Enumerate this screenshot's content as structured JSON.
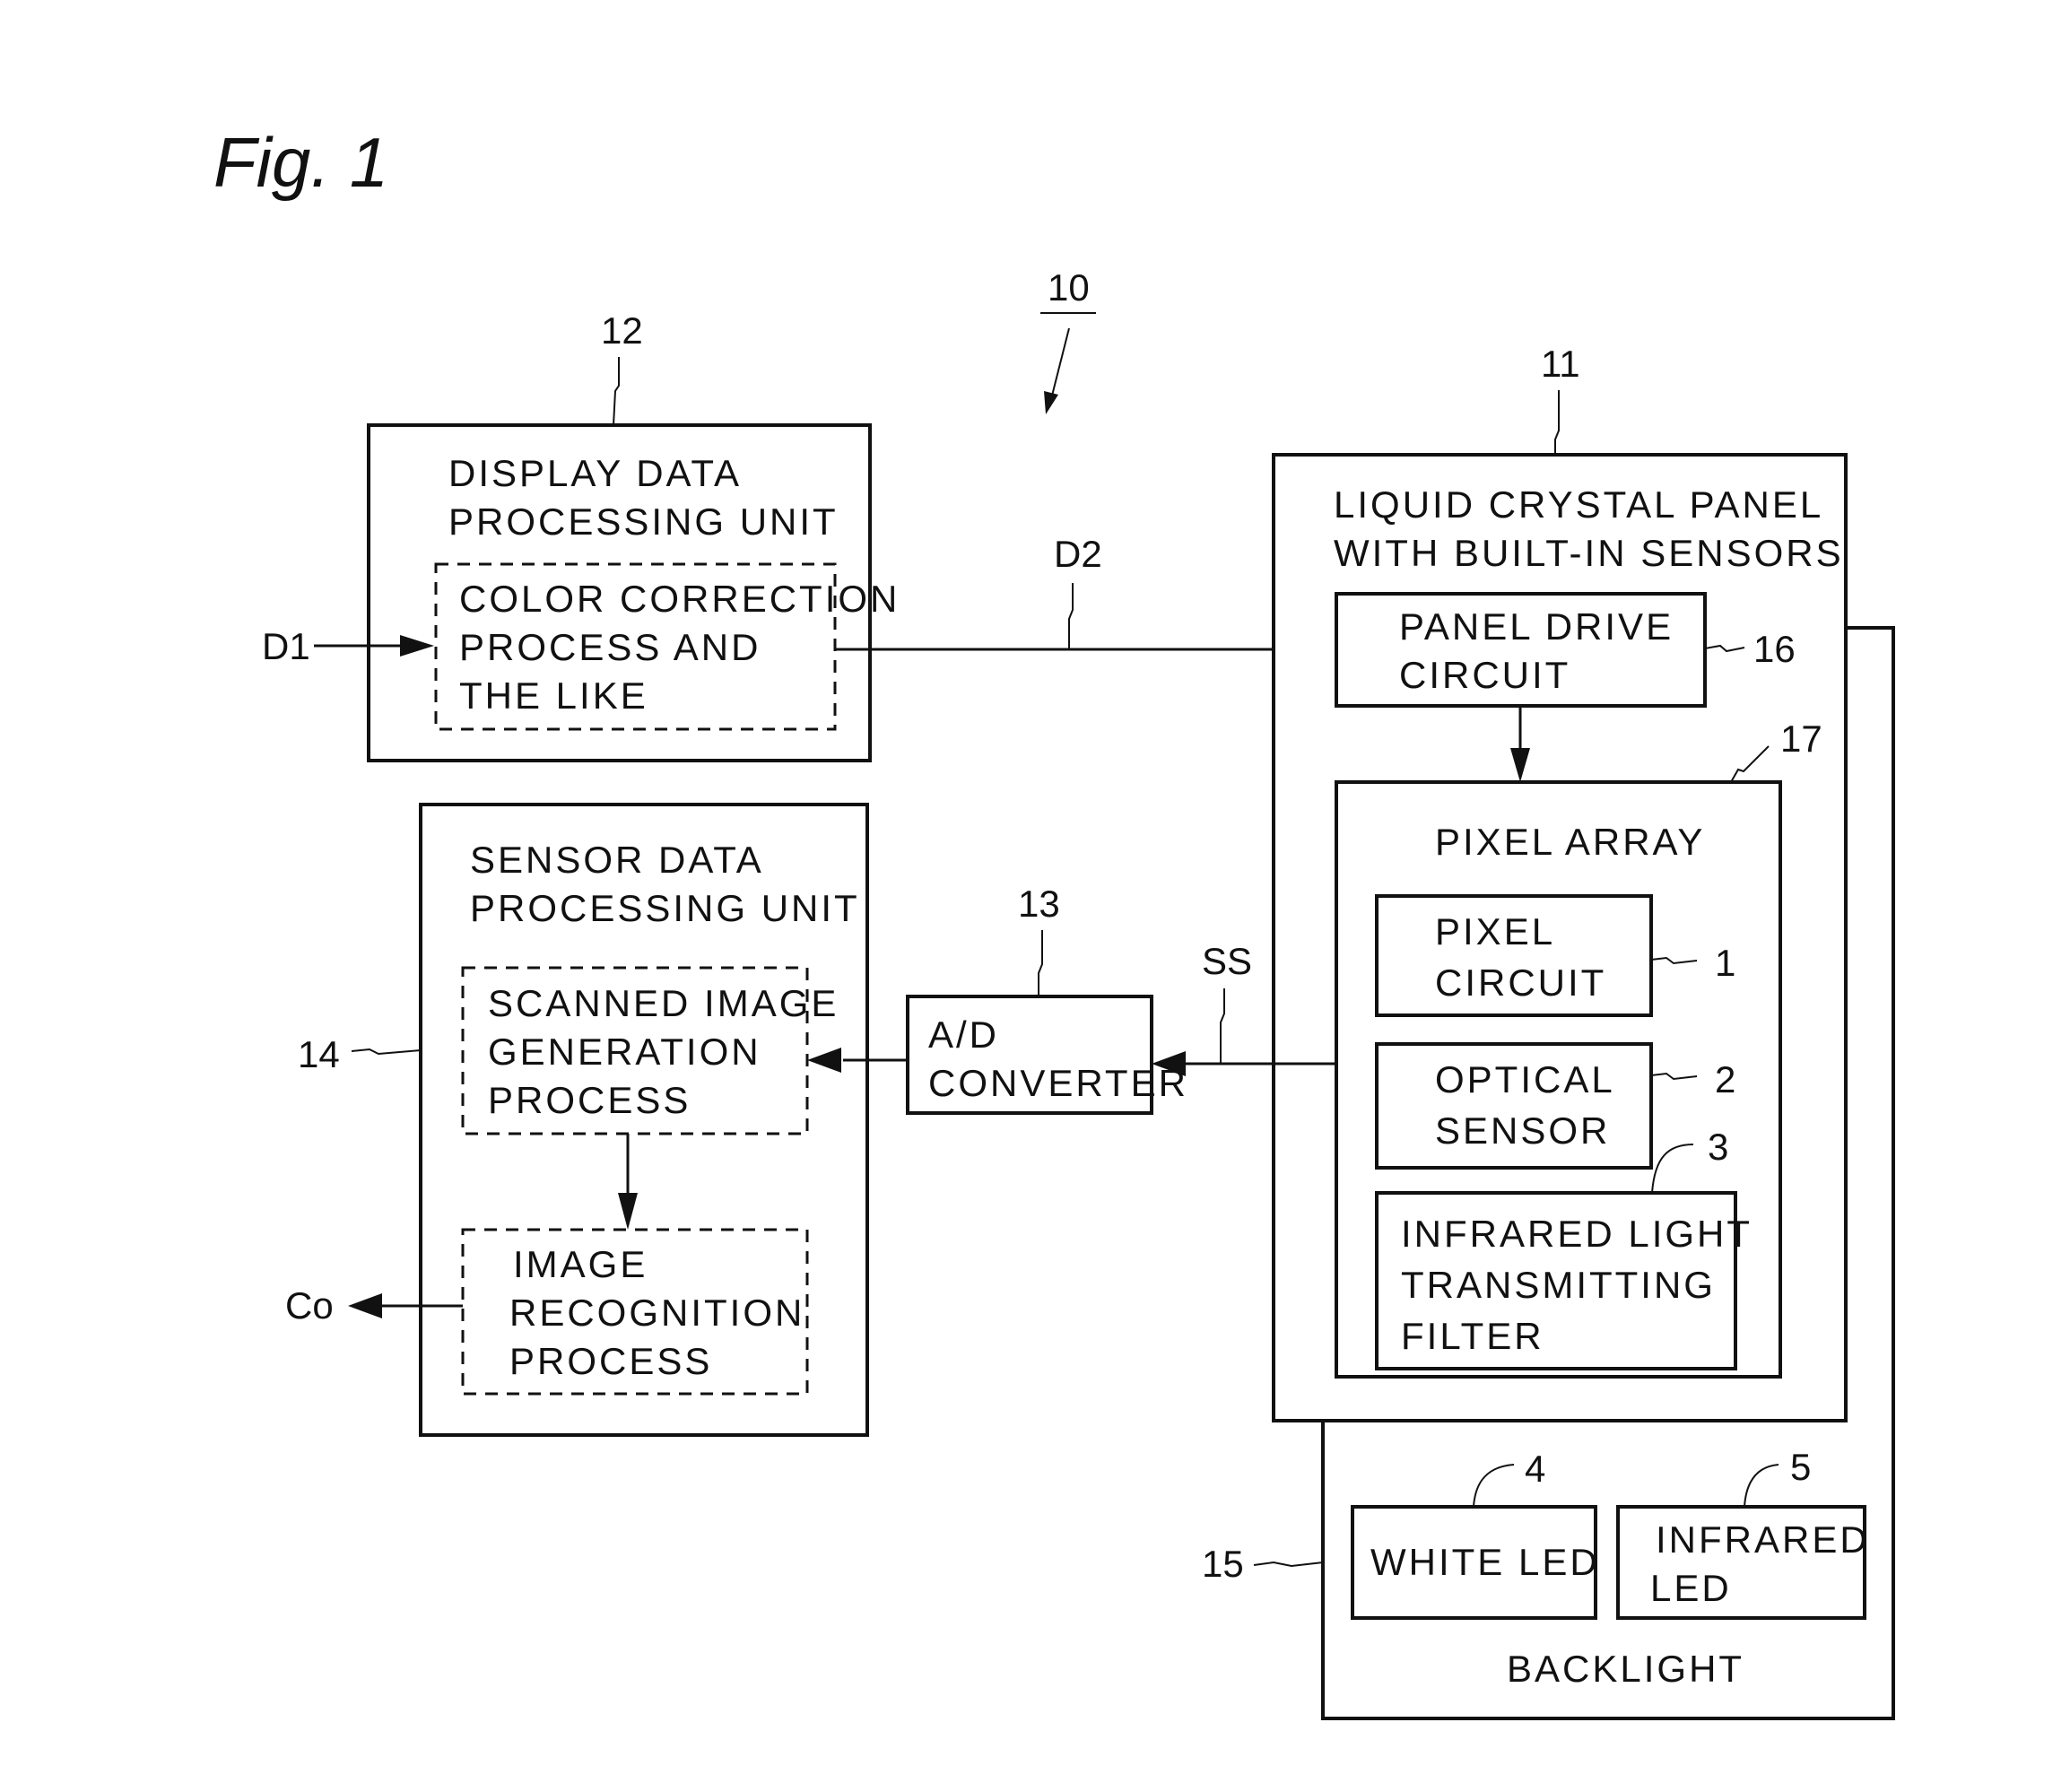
{
  "figure": {
    "title": "Fig. 1",
    "system_ref": "10"
  },
  "blocks": {
    "display_unit": {
      "ref": "12",
      "lines": [
        "DISPLAY DATA",
        "PROCESSING UNIT"
      ],
      "inner": {
        "lines": [
          "COLOR CORRECTION",
          "PROCESS AND",
          "THE LIKE"
        ]
      }
    },
    "lcd_panel": {
      "ref": "11",
      "lines": [
        "LIQUID CRYSTAL PANEL",
        "WITH BUILT-IN SENSORS"
      ]
    },
    "panel_drive": {
      "ref": "16",
      "lines": [
        "PANEL DRIVE",
        "CIRCUIT"
      ]
    },
    "pixel_array": {
      "ref": "17",
      "title": "PIXEL ARRAY"
    },
    "pixel_circuit": {
      "ref": "1",
      "lines": [
        "PIXEL",
        "CIRCUIT"
      ]
    },
    "optical_sensor": {
      "ref": "2",
      "lines": [
        "OPTICAL",
        "SENSOR"
      ]
    },
    "ir_filter": {
      "ref": "3",
      "lines": [
        "INFRARED LIGHT",
        "TRANSMITTING",
        "FILTER"
      ]
    },
    "sensor_unit": {
      "ref": "14",
      "lines": [
        "SENSOR DATA",
        "PROCESSING UNIT"
      ],
      "scanned": {
        "lines": [
          "SCANNED IMAGE",
          "GENERATION",
          "PROCESS"
        ]
      },
      "recognition": {
        "lines": [
          "IMAGE",
          "RECOGNITION",
          "PROCESS"
        ]
      }
    },
    "ad_converter": {
      "ref": "13",
      "lines": [
        "A/D",
        "CONVERTER"
      ]
    },
    "backlight": {
      "ref": "15",
      "title": "BACKLIGHT"
    },
    "white_led": {
      "ref": "4",
      "lines": [
        "WHITE LED"
      ]
    },
    "infrared_led": {
      "ref": "5",
      "lines": [
        "INFRARED",
        "LED"
      ]
    }
  },
  "signals": {
    "d1": "D1",
    "d2": "D2",
    "ss": "SS",
    "co": "Co"
  }
}
